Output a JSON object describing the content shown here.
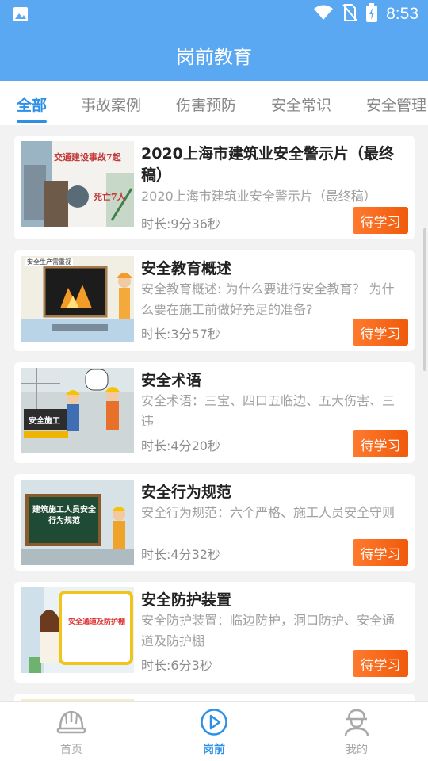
{
  "status_bar": {
    "time": "8:53"
  },
  "app_bar": {
    "title": "岗前教育"
  },
  "tabs": [
    {
      "label": "全部",
      "active": true
    },
    {
      "label": "事故案例",
      "active": false
    },
    {
      "label": "伤害预防",
      "active": false
    },
    {
      "label": "安全常识",
      "active": false
    },
    {
      "label": "安全管理",
      "active": false
    }
  ],
  "courses": [
    {
      "title": "2020上海市建筑业安全警示片（最终稿）",
      "desc": "2020上海市建筑业安全警示片（最终稿）",
      "duration": "时长:9分36秒",
      "button": "待学习",
      "thumb_text": [
        "交通建设事故7起",
        "死亡7人"
      ]
    },
    {
      "title": "安全教育概述",
      "desc": "安全教育概述: 为什么要进行安全教育？ 为什么要在施工前做好充足的准备?",
      "duration": "时长:3分57秒",
      "button": "待学习",
      "thumb_text": [
        "安全生产需重视"
      ]
    },
    {
      "title": "安全术语",
      "desc": "安全术语：三宝、四口五临边、五大伤害、三违",
      "duration": "时长:4分20秒",
      "button": "待学习",
      "thumb_text": [
        "安全施工"
      ]
    },
    {
      "title": "安全行为规范",
      "desc": "安全行为规范：六个严格、施工人员安全守则",
      "duration": "时长:4分32秒",
      "button": "待学习",
      "thumb_text": [
        "建筑施工人员安全行为规范"
      ]
    },
    {
      "title": "安全防护装置",
      "desc": "安全防护装置：临边防护，洞口防护、安全通道及防护棚",
      "duration": "时长:6分3秒",
      "button": "待学习",
      "thumb_text": [
        "安全通道及防护棚"
      ]
    }
  ],
  "bottom_nav": [
    {
      "label": "首页",
      "icon": "helmet-icon",
      "active": false
    },
    {
      "label": "岗前",
      "icon": "play-circle-icon",
      "active": true
    },
    {
      "label": "我的",
      "icon": "person-helmet-icon",
      "active": false
    }
  ],
  "colors": {
    "primary": "#5aa7f2",
    "tab_active": "#2e8fe6",
    "button": "#f26a1b"
  }
}
